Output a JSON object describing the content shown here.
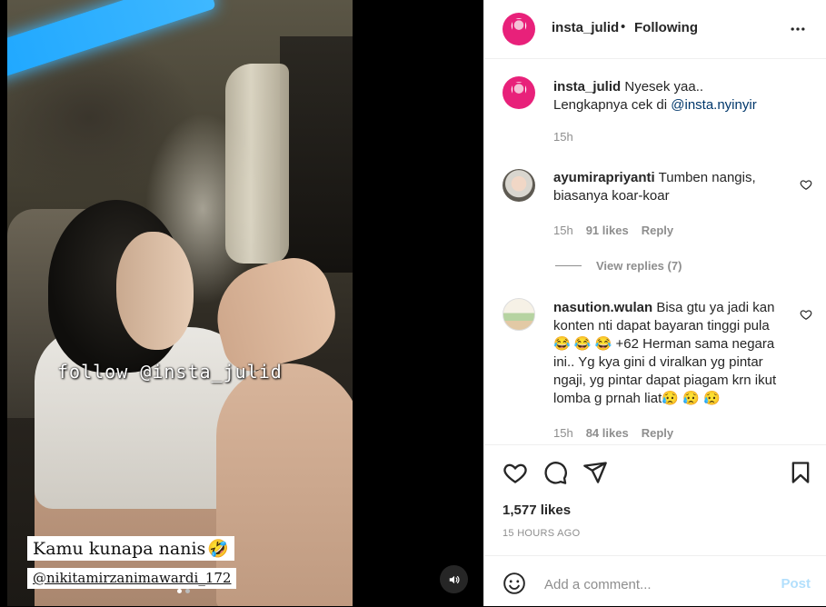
{
  "media": {
    "video_watermark": "follow @insta_julid",
    "caption_text": "Kamu kunapa nanis",
    "caption_emoji": "🤣",
    "caption_handle": "@nikitamirzanimawardi_172",
    "sound_icon": "speaker-icon",
    "carousel_dots": 2
  },
  "header": {
    "username": "insta_julid",
    "separator": "•",
    "follow_label": "Following",
    "more_icon": "more-icon"
  },
  "caption": {
    "username": "insta_julid",
    "text_line1": "Nyesek yaa..",
    "text_line2": "Lengkapnya cek di",
    "mention": "@insta.nyinyir",
    "time": "15h"
  },
  "comments": [
    {
      "username": "ayumirapriyanti",
      "text": "Tumben nangis, biasanya koar-koar",
      "time": "15h",
      "likes": "91 likes",
      "reply_label": "Reply",
      "view_replies": "View replies (7)"
    },
    {
      "username": "nasution.wulan",
      "text_a": "Bisa gtu ya jadi kan konten nti dapat bayaran tinggi pula",
      "emoji_a": "😂 😂 😂",
      "text_b": "+62 Herman sama negara ini.. Yg kya gini d viralkan yg pintar ngaji, yg pintar dapat piagam krn ikut lomba g prnah liat",
      "emoji_b": "😥 😥 😥",
      "time": "15h",
      "likes": "84 likes",
      "reply_label": "Reply"
    }
  ],
  "actions": {
    "likes": "1,577 likes",
    "ago": "15 HOURS AGO"
  },
  "add_comment": {
    "placeholder": "Add a comment...",
    "post_label": "Post"
  }
}
